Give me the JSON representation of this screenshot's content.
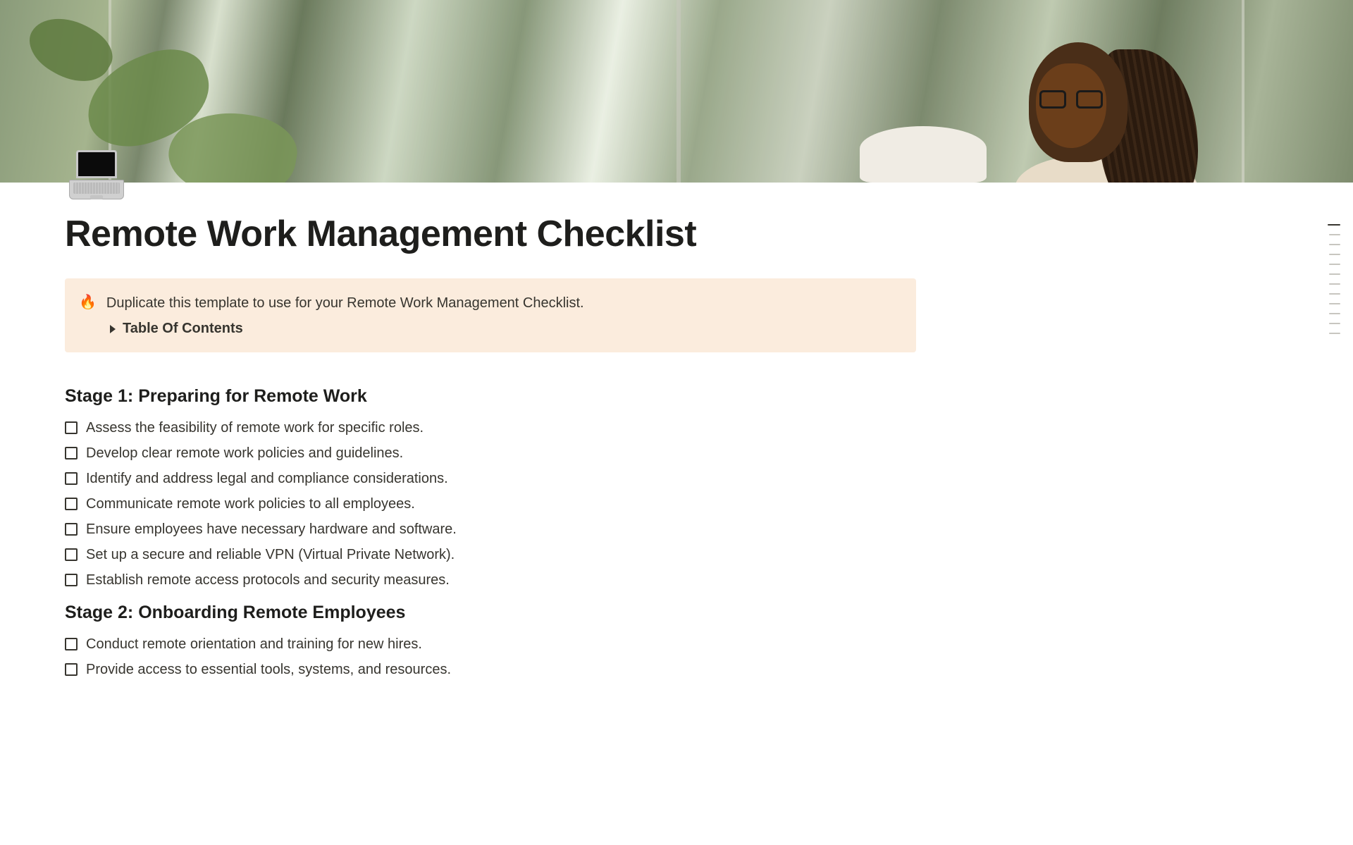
{
  "icon_name": "laptop-emoji",
  "title": "Remote Work Management Checklist",
  "callout": {
    "emoji": "🔥",
    "text": "Duplicate this template to use for your Remote Work Management Checklist.",
    "toc_label": "Table Of Contents"
  },
  "stages": [
    {
      "heading": "Stage 1: Preparing for Remote Work",
      "items": [
        "Assess the feasibility of remote work for specific roles.",
        "Develop clear remote work policies and guidelines.",
        "Identify and address legal and compliance considerations.",
        "Communicate remote work policies to all employees.",
        "Ensure employees have necessary hardware and software.",
        "Set up a secure and reliable VPN (Virtual Private Network).",
        "Establish remote access protocols and security measures."
      ]
    },
    {
      "heading": "Stage 2: Onboarding Remote Employees",
      "items": [
        "Conduct remote orientation and training for new hires.",
        "Provide access to essential tools, systems, and resources."
      ]
    }
  ],
  "outline_count": 12
}
